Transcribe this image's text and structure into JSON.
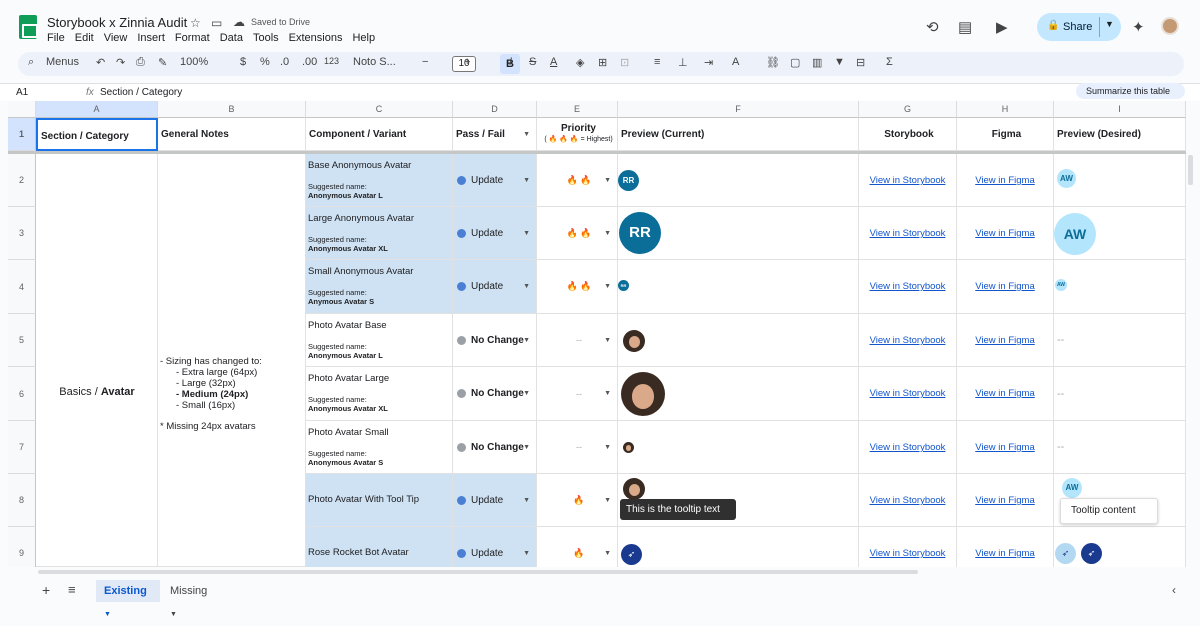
{
  "app": {
    "title": "Storybook x Zinnia Audit",
    "saved": "Saved to Drive",
    "share": "Share"
  },
  "menu": [
    "File",
    "Edit",
    "View",
    "Insert",
    "Format",
    "Data",
    "Tools",
    "Extensions",
    "Help"
  ],
  "toolbar": {
    "search": "Menus",
    "zoom": "100%",
    "currency": "$",
    "percent": "%",
    "dec_dec": ".0",
    "dec_inc": ".00",
    "num_fmt": "123",
    "font": "Noto S...",
    "font_size": "10",
    "bold": "B",
    "italic": "I",
    "sum": "Σ"
  },
  "formula": {
    "cell": "A1",
    "value": "Section / Category",
    "summarize": "Summarize this table"
  },
  "columns": [
    "A",
    "B",
    "C",
    "D",
    "E",
    "F",
    "G",
    "H",
    "I"
  ],
  "headers": {
    "a": "Section / Category",
    "b": "General Notes",
    "c": "Component / Variant",
    "d": "Pass / Fail",
    "e": "Priority",
    "e_sub": "( 🔥 🔥 🔥 = Highest)",
    "f": "Preview (Current)",
    "g": "Storybook",
    "h": "Figma",
    "i": "Preview (Desired)"
  },
  "section": {
    "prefix": "Basics / ",
    "bold": "Avatar"
  },
  "notes": {
    "l1": "- Sizing has changed to:",
    "l2": "- Extra large (64px)",
    "l3": "- Large (32px)",
    "l4": "- Medium (24px)",
    "l5": "- Small (16px)",
    "l6": "* Missing 24px avatars"
  },
  "rows": [
    {
      "num": "2",
      "name": "Base Anonymous Avatar",
      "sn_label": "Suggested name:",
      "sn": "Anonymous Avatar L",
      "status": "Update",
      "priority": "🔥 🔥",
      "init": "RR",
      "desired": "AW"
    },
    {
      "num": "3",
      "name": "Large Anonymous Avatar",
      "sn_label": "Suggested name:",
      "sn": "Anonymous Avatar XL",
      "status": "Update",
      "priority": "🔥 🔥",
      "init": "RR",
      "desired": "AW"
    },
    {
      "num": "4",
      "name": "Small Anonymous Avatar",
      "sn_label": "Suggested name:",
      "sn": "Anymous Avatar S",
      "status": "Update",
      "priority": "🔥 🔥",
      "init": "RR",
      "desired": "AW"
    },
    {
      "num": "5",
      "name": "Photo Avatar Base",
      "sn_label": "Suggested name:",
      "sn": "Anonymous Avatar L",
      "status": "No Change",
      "priority": "--",
      "desired": "--"
    },
    {
      "num": "6",
      "name": "Photo Avatar Large",
      "sn_label": "Suggested name:",
      "sn": "Anonymous Avatar XL",
      "status": "No Change",
      "priority": "--",
      "desired": "--"
    },
    {
      "num": "7",
      "name": "Photo Avatar Small",
      "sn_label": "Suggested name:",
      "sn": "Anonymous Avatar S",
      "status": "No Change",
      "priority": "--",
      "desired": "--"
    },
    {
      "num": "8",
      "name": "Photo Avatar With Tool Tip",
      "status": "Update",
      "priority": "🔥",
      "desired": "AW"
    },
    {
      "num": "9",
      "name": "Rose Rocket Bot Avatar",
      "status": "Update",
      "priority": "🔥"
    }
  ],
  "links": {
    "storybook": "View in Storybook",
    "figma": "View in Figma"
  },
  "tooltip": {
    "current": "This is the tooltip text",
    "desired": "Tooltip content"
  },
  "tabs": {
    "existing": "Existing",
    "missing": "Missing"
  },
  "colors": {
    "update": "#4a7fd4",
    "nochange": "#9aa0a6",
    "blue_fill": "#cfe2f3"
  }
}
